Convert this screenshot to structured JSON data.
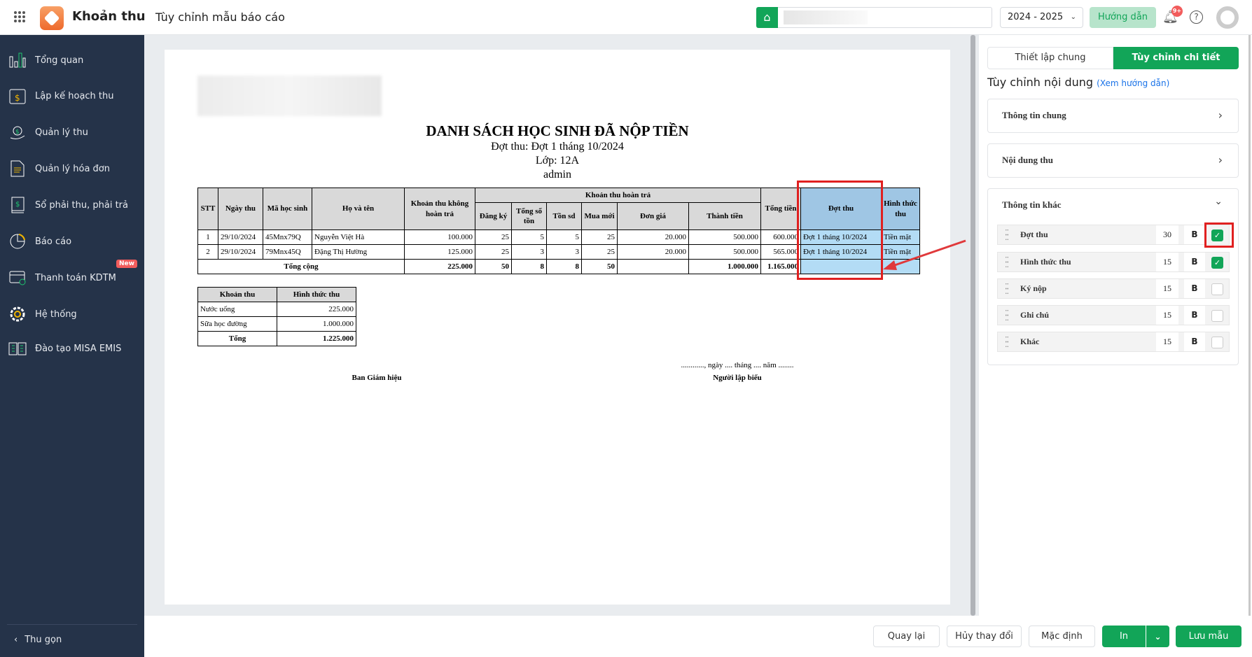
{
  "header": {
    "app_title": "Khoản thu",
    "page_title": "Tùy chỉnh mẫu báo cáo",
    "school_year": "2024 - 2025",
    "guide_button": "Hướng dẫn",
    "notif_badge": "9+"
  },
  "sidebar": {
    "items": [
      {
        "label": "Tổng quan",
        "icon": "bar-chart-icon"
      },
      {
        "label": "Lập kế hoạch thu",
        "icon": "calendar-dollar-icon"
      },
      {
        "label": "Quản lý thu",
        "icon": "hand-coin-icon"
      },
      {
        "label": "Quản lý hóa đơn",
        "icon": "invoice-icon"
      },
      {
        "label": "Sổ phải thu, phải trả",
        "icon": "ledger-icon"
      },
      {
        "label": "Báo cáo",
        "icon": "pie-chart-icon"
      },
      {
        "label": "Thanh toán KDTM",
        "icon": "card-check-icon",
        "badge": "New"
      },
      {
        "label": "Hệ thống",
        "icon": "gear-icon"
      },
      {
        "label": "Đào tạo MISA EMIS",
        "icon": "book-icon"
      }
    ],
    "collapse_label": "Thu gọn"
  },
  "report": {
    "title": "DANH SÁCH HỌC SINH ĐÃ NỘP TIỀN",
    "subtitle1": "Đợt thu: Đợt 1 tháng 10/2024",
    "subtitle2": "Lớp: 12A",
    "subtitle3": "admin",
    "headers": {
      "stt": "STT",
      "ngay": "Ngày thu",
      "ma": "Mã học sinh",
      "ten": "Họ và tên",
      "khong_hoan": "Khoản thu không hoàn trả",
      "hoan_tra": "Khoản thu hoàn trả",
      "dang_ky": "Đăng ký",
      "tong_ton": "Tổng số tồn",
      "ton_sd": "Tồn sd",
      "mua_moi": "Mua mới",
      "don_gia": "Đơn giá",
      "thanh_tien": "Thành tiền",
      "tong_tien": "Tổng tiền",
      "dot_thu": "Đợt thu",
      "hinh_thuc": "Hình thức thu"
    },
    "rows": [
      {
        "stt": "1",
        "ngay": "29/10/2024",
        "ma": "45Mnx79Q",
        "ten": "Nguyễn Việt Hà",
        "khong_hoan": "100.000",
        "dang_ky": "25",
        "tong_ton": "5",
        "ton_sd": "5",
        "mua_moi": "25",
        "don_gia": "20.000",
        "thanh_tien": "500.000",
        "tong_tien": "600.000",
        "dot_thu": "Đợt 1 tháng 10/2024",
        "hinh_thuc": "Tiền mặt"
      },
      {
        "stt": "2",
        "ngay": "29/10/2024",
        "ma": "79Mnx45Q",
        "ten": "Đặng Thị Hường",
        "khong_hoan": "125.000",
        "dang_ky": "25",
        "tong_ton": "3",
        "ton_sd": "3",
        "mua_moi": "25",
        "don_gia": "20.000",
        "thanh_tien": "500.000",
        "tong_tien": "565.000",
        "dot_thu": "Đợt 1 tháng 10/2024",
        "hinh_thuc": "Tiền mặt"
      }
    ],
    "total": {
      "label": "Tổng cộng",
      "khong_hoan": "225.000",
      "dang_ky": "50",
      "tong_ton": "8",
      "ton_sd": "8",
      "mua_moi": "50",
      "thanh_tien": "1.000.000",
      "tong_tien": "1.165.000"
    },
    "summary": {
      "headers": [
        "Khoản thu",
        "Hình thức thu"
      ],
      "rows": [
        [
          "Nước uống",
          "225.000"
        ],
        [
          "Sữa học đường",
          "1.000.000"
        ]
      ],
      "total": [
        "Tổng",
        "1.225.000"
      ]
    },
    "sign_left": "Ban Giám hiệu",
    "date_line": "............, ngày .... tháng .... năm ........",
    "sign_right": "Người lập biểu"
  },
  "panel": {
    "tabs": [
      "Thiết lập chung",
      "Tùy chỉnh chi tiết"
    ],
    "heading": "Tùy chỉnh nội dung",
    "guide_link": "(Xem hướng dẫn)",
    "sections": [
      "Thông tin chung",
      "Nội dung thu",
      "Thông tin khác"
    ],
    "fields": [
      {
        "label": "Đợt thu",
        "width": "30",
        "bold": "B",
        "checked": true
      },
      {
        "label": "Hình thức thu",
        "width": "15",
        "bold": "B",
        "checked": true
      },
      {
        "label": "Ký nộp",
        "width": "15",
        "bold": "B",
        "checked": false
      },
      {
        "label": "Ghi chú",
        "width": "15",
        "bold": "B",
        "checked": false
      },
      {
        "label": "Khác",
        "width": "15",
        "bold": "B",
        "checked": false
      }
    ]
  },
  "footer": {
    "back": "Quay lại",
    "discard": "Hủy thay đổi",
    "default": "Mặc định",
    "print": "In",
    "save": "Lưu mẫu"
  },
  "colors": {
    "sidebar": "#253349",
    "accent": "#12a558",
    "highlight": "#9fc6e4",
    "annotation": "#e02020"
  }
}
